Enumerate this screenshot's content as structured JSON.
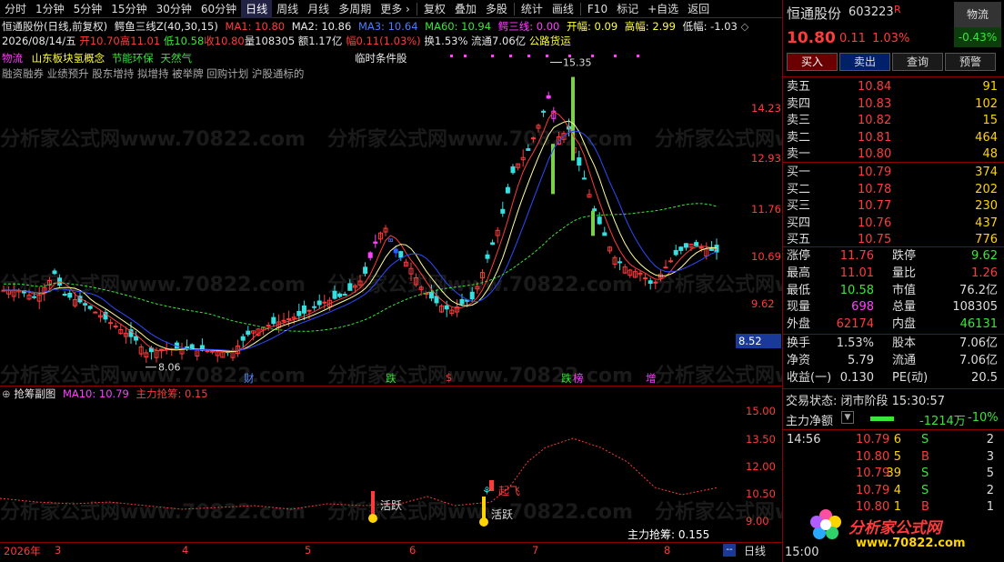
{
  "toolbar": {
    "items": [
      "分时",
      "1分钟",
      "5分钟",
      "15分钟",
      "30分钟",
      "60分钟",
      "日线",
      "周线",
      "月线",
      "多周期",
      "更多 ›",
      "复权",
      "叠加",
      "多股",
      "统计",
      "画线",
      "F10",
      "标记",
      "+自选",
      "返回"
    ],
    "active_index": 6
  },
  "header": {
    "title": "恒通股份(日线,前复权)",
    "indicator": "鳄鱼三线Z(40,30,15)",
    "ma1": "MA1: 10.80",
    "ma2": "MA2: 10.86",
    "ma3": "MA3: 10.64",
    "ma60": "MA60: 10.94",
    "e3": "鳄三线: 0.00",
    "kf": "开幅: 0.09",
    "gf": "高幅: 2.99",
    "df": "低幅: -1.03",
    "date": "2026/08/14/五",
    "open": "开10.70",
    "high": "高11.01",
    "low": "低10.58",
    "close": "收10.80",
    "vol": "量108305",
    "amt": "额1.17亿",
    "chg": "幅0.11(1.03%)",
    "turn": "换1.53%",
    "float": "流通7.06亿",
    "sector": "公路货运",
    "tags1": [
      "物流",
      "山东板块",
      "氢概念",
      "节能环保",
      "天然气"
    ],
    "tags2": "融资融券 业绩预升 股东增持 拟增持 被举牌 回购计划 沪股通标的",
    "cond": "临时条件股"
  },
  "main_chart": {
    "y_ticks": [
      "14.23",
      "12.93",
      "11.76",
      "10.69",
      "9.62"
    ],
    "price_box": "8.52",
    "max_label": "15.35",
    "min_label": "8.06",
    "events": [
      "财",
      "跌",
      "$",
      "跌",
      "榜",
      "增"
    ]
  },
  "sub_chart": {
    "title": "抢筹副图",
    "ma10": "MA10: 10.79",
    "zl": "主力抢筹: 0.15",
    "y_ticks": [
      "15.00",
      "13.50",
      "12.00",
      "10.50",
      "9.00"
    ],
    "markers": [
      "活跃",
      "活跃",
      "起飞"
    ],
    "bottom_text": "主力抢筹:  0.155"
  },
  "x_axis": {
    "labels": [
      "2026年",
      "3",
      "4",
      "5",
      "6",
      "7",
      "8"
    ],
    "period": "日线"
  },
  "right_panel": {
    "name": "恒通股份",
    "code": "603223",
    "flag": "R",
    "sector_btn": "物流",
    "sector_chg": "-0.43%",
    "price": "10.80",
    "chg": "0.11",
    "pct": "1.03%",
    "buttons": [
      "买入",
      "卖出",
      "查询",
      "预警"
    ],
    "asks": [
      {
        "label": "卖五",
        "price": "10.84",
        "vol": "91"
      },
      {
        "label": "卖四",
        "price": "10.83",
        "vol": "102"
      },
      {
        "label": "卖三",
        "price": "10.82",
        "vol": "15"
      },
      {
        "label": "卖二",
        "price": "10.81",
        "vol": "464"
      },
      {
        "label": "卖一",
        "price": "10.80",
        "vol": "48"
      }
    ],
    "bids": [
      {
        "label": "买一",
        "price": "10.79",
        "vol": "374"
      },
      {
        "label": "买二",
        "price": "10.78",
        "vol": "202"
      },
      {
        "label": "买三",
        "price": "10.77",
        "vol": "230"
      },
      {
        "label": "买四",
        "price": "10.76",
        "vol": "437"
      },
      {
        "label": "买五",
        "price": "10.75",
        "vol": "776"
      }
    ],
    "stats": [
      {
        "l1": "涨停",
        "v1": "11.76",
        "c1": "red",
        "l2": "跌停",
        "v2": "9.62",
        "c2": "green"
      },
      {
        "l1": "最高",
        "v1": "11.01",
        "c1": "red",
        "l2": "量比",
        "v2": "1.26",
        "c2": "red"
      },
      {
        "l1": "最低",
        "v1": "10.58",
        "c1": "green",
        "l2": "市值",
        "v2": "76.2亿",
        "c2": "white"
      },
      {
        "l1": "现量",
        "v1": "698",
        "c1": "mag",
        "l2": "总量",
        "v2": "108305",
        "c2": "white"
      },
      {
        "l1": "外盘",
        "v1": "62174",
        "c1": "red",
        "l2": "内盘",
        "v2": "46131",
        "c2": "green"
      }
    ],
    "stats2": [
      {
        "l1": "换手",
        "v1": "1.53%",
        "l2": "股本",
        "v2": "7.06亿"
      },
      {
        "l1": "净资",
        "v1": "5.79",
        "l2": "流通",
        "v2": "7.06亿"
      },
      {
        "l1": "收益(一)",
        "v1": "0.130",
        "l2": "PE(动)",
        "v2": "20.5"
      }
    ],
    "trade_state": "交易状态: 闭市阶段 15:30:57",
    "net_flow_label": "主力净额",
    "net_flow": "-1214万",
    "net_pct": "-10%",
    "ticks": [
      {
        "time": "14:56",
        "price": "10.79",
        "vol": "6",
        "bs": "S",
        "n": "2"
      },
      {
        "time": "",
        "price": "10.80",
        "vol": "5",
        "bs": "B",
        "n": "3"
      },
      {
        "time": "",
        "price": "10.79",
        "vol": "39",
        "bs": "S",
        "n": "5"
      },
      {
        "time": "",
        "price": "10.79",
        "vol": "4",
        "bs": "S",
        "n": "2"
      },
      {
        "time": "",
        "price": "10.80",
        "vol": "1",
        "bs": "B",
        "n": "1"
      }
    ],
    "logo_text": "分析家公式网",
    "logo_url": "www.70822.com",
    "bottom_time": "15:00"
  },
  "watermark": "分析家公式网www.70822.com"
}
